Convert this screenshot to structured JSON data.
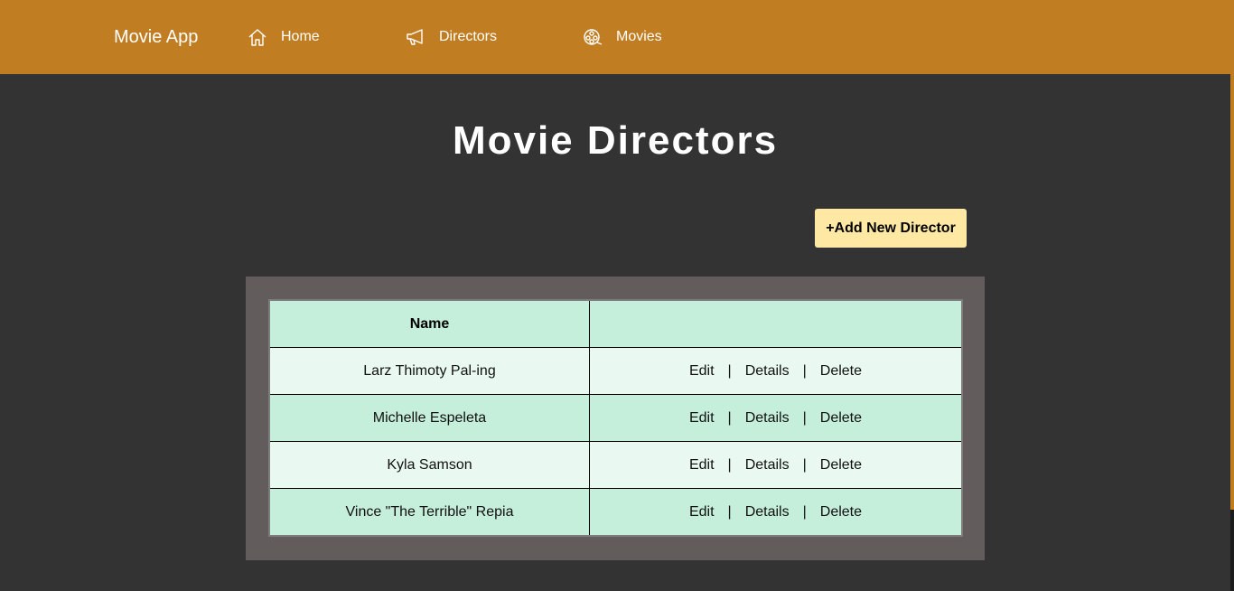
{
  "nav": {
    "brand": "Movie App",
    "links": [
      {
        "label": "Home",
        "icon": "home-icon"
      },
      {
        "label": "Directors",
        "icon": "megaphone-icon"
      },
      {
        "label": "Movies",
        "icon": "film-reel-icon"
      }
    ]
  },
  "page": {
    "title": "Movie Directors",
    "add_button_label": "+Add New Director"
  },
  "table": {
    "columns": [
      "Name",
      ""
    ],
    "actions": [
      "Edit",
      "Details",
      "Delete"
    ],
    "separator": "|",
    "rows": [
      {
        "name": "Larz Thimoty Pal-ing"
      },
      {
        "name": "Michelle Espeleta"
      },
      {
        "name": "Kyla Samson"
      },
      {
        "name": "Vince \"The Terrible\" Repia"
      }
    ]
  },
  "colors": {
    "navbar": "#c17d22",
    "background": "#333333",
    "button": "#ffe8a3",
    "panel": "#625d5c",
    "row_light": "#e9f8f1",
    "row_dark": "#c5eedb"
  }
}
